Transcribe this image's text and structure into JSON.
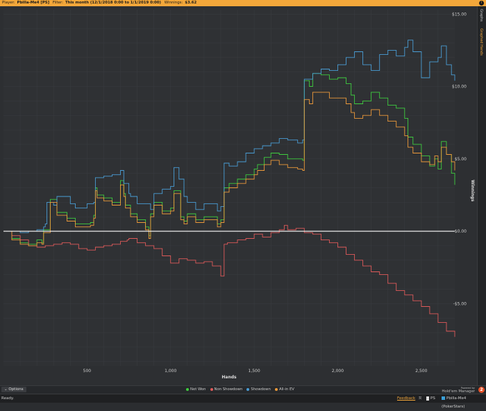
{
  "header": {
    "player_label": "Player:",
    "player_value": "Pbilla-Me4 [PS]",
    "filter_label": "Filter:",
    "filter_value": "This month (12/1/2018 0:00 to 1/1/2019 0:00)",
    "winnings_label": "Winnings:",
    "winnings_value": "$3.62",
    "info_icon": "info-icon"
  },
  "side_tabs": [
    "Graphs",
    "Graphed Hands"
  ],
  "chart_data": {
    "type": "line",
    "title": "",
    "xlabel": "Hands",
    "ylabel": "Winnings",
    "xlim": [
      0,
      2700
    ],
    "ylim": [
      -9.3,
      15.3
    ],
    "x_ticks": [
      500,
      1000,
      1500,
      2000,
      2500
    ],
    "x_tick_labels": [
      "500",
      "1,000",
      "1,500",
      "2,000",
      "2,500"
    ],
    "y_ticks": [
      -5,
      0,
      5,
      10,
      15
    ],
    "y_tick_labels": [
      "-$5.00",
      "$0.00",
      "$5.00",
      "$10.00",
      "$15.00"
    ],
    "grid": true,
    "legend": "bottom",
    "series": [
      {
        "name": "Net Won",
        "color": "#3fce3f",
        "x": [
          0,
          50,
          100,
          150,
          200,
          230,
          240,
          280,
          320,
          380,
          430,
          470,
          520,
          540,
          550,
          560,
          600,
          650,
          700,
          720,
          730,
          760,
          800,
          850,
          870,
          880,
          900,
          950,
          1000,
          1020,
          1060,
          1080,
          1100,
          1150,
          1200,
          1280,
          1300,
          1320,
          1350,
          1400,
          1450,
          1500,
          1520,
          1560,
          1600,
          1650,
          1700,
          1760,
          1790,
          1800,
          1830,
          1850,
          1900,
          1950,
          2000,
          2050,
          2080,
          2100,
          2150,
          2200,
          2250,
          2300,
          2350,
          2400,
          2420,
          2450,
          2500,
          2550,
          2580,
          2600,
          2620,
          2650,
          2680,
          2700
        ],
        "values": [
          0.0,
          -0.5,
          -0.8,
          -0.9,
          -0.6,
          -0.8,
          0.1,
          2.2,
          1.3,
          0.9,
          0.5,
          0.5,
          0.6,
          1.1,
          3.0,
          2.5,
          2.3,
          2.0,
          3.5,
          2.6,
          1.8,
          1.2,
          0.8,
          0.3,
          -0.3,
          1.2,
          2.0,
          1.4,
          1.6,
          2.8,
          1.0,
          0.7,
          1.2,
          0.8,
          1.0,
          0.5,
          0.8,
          3.0,
          3.3,
          3.6,
          3.9,
          4.3,
          4.6,
          5.1,
          5.4,
          5.3,
          5.0,
          5.0,
          4.9,
          10.4,
          10.0,
          10.9,
          10.8,
          10.5,
          10.6,
          10.2,
          9.4,
          8.8,
          9.0,
          9.6,
          9.2,
          8.7,
          8.5,
          7.8,
          6.5,
          6.0,
          5.2,
          4.5,
          5.0,
          4.3,
          6.2,
          5.3,
          4.0,
          3.2
        ]
      },
      {
        "name": "Non Showdown",
        "color": "#e05a5a",
        "x": [
          0,
          50,
          100,
          150,
          200,
          250,
          300,
          350,
          400,
          450,
          500,
          550,
          600,
          650,
          700,
          740,
          750,
          800,
          850,
          900,
          950,
          1000,
          1050,
          1100,
          1150,
          1200,
          1250,
          1300,
          1320,
          1340,
          1400,
          1450,
          1500,
          1550,
          1600,
          1650,
          1680,
          1700,
          1750,
          1800,
          1850,
          1900,
          1950,
          2000,
          2050,
          2100,
          2150,
          2200,
          2250,
          2300,
          2350,
          2400,
          2450,
          2500,
          2550,
          2600,
          2650,
          2700
        ],
        "values": [
          0.0,
          -0.3,
          -0.6,
          -1.0,
          -1.1,
          -1.0,
          -0.9,
          -0.8,
          -0.9,
          -1.2,
          -1.3,
          -1.1,
          -1.0,
          -0.9,
          -0.7,
          -0.6,
          -0.5,
          -0.8,
          -1.0,
          -1.2,
          -1.7,
          -2.2,
          -1.9,
          -2.0,
          -2.2,
          -2.1,
          -2.4,
          -3.1,
          -0.9,
          -0.8,
          -0.6,
          -0.5,
          -0.2,
          -0.4,
          -0.1,
          0.1,
          0.4,
          0.1,
          0.2,
          -0.1,
          -0.2,
          -0.6,
          -0.8,
          -1.1,
          -1.6,
          -2.0,
          -2.4,
          -2.8,
          -3.0,
          -3.6,
          -4.1,
          -4.4,
          -4.8,
          -5.2,
          -5.7,
          -6.3,
          -6.9,
          -7.3
        ]
      },
      {
        "name": "Showdown",
        "color": "#4a9ed6",
        "x": [
          0,
          100,
          150,
          200,
          240,
          250,
          260,
          300,
          320,
          400,
          430,
          500,
          540,
          550,
          600,
          650,
          700,
          720,
          750,
          760,
          800,
          850,
          880,
          900,
          950,
          1000,
          1020,
          1050,
          1080,
          1100,
          1150,
          1200,
          1280,
          1300,
          1320,
          1350,
          1400,
          1450,
          1500,
          1550,
          1600,
          1650,
          1700,
          1760,
          1790,
          1800,
          1850,
          1900,
          1950,
          2000,
          2050,
          2100,
          2150,
          2200,
          2250,
          2300,
          2350,
          2400,
          2420,
          2450,
          2500,
          2550,
          2600,
          2620,
          2650,
          2680,
          2700
        ],
        "values": [
          0.0,
          -0.1,
          0.0,
          0.1,
          0.3,
          0.5,
          2.0,
          1.8,
          2.4,
          1.9,
          1.6,
          1.9,
          2.0,
          3.7,
          3.8,
          3.9,
          4.2,
          3.3,
          2.6,
          2.4,
          1.9,
          1.9,
          1.5,
          2.6,
          2.9,
          3.1,
          4.4,
          3.6,
          2.4,
          2.0,
          1.5,
          1.9,
          1.4,
          1.7,
          4.7,
          4.5,
          4.8,
          5.4,
          5.7,
          5.9,
          6.1,
          6.4,
          6.3,
          6.1,
          6.3,
          10.5,
          10.9,
          11.2,
          11.1,
          11.5,
          12.0,
          12.4,
          11.5,
          11.1,
          12.2,
          12.5,
          12.1,
          12.7,
          13.2,
          12.4,
          10.6,
          11.7,
          12.0,
          12.8,
          11.5,
          10.8,
          10.4
        ]
      },
      {
        "name": "All-in EV",
        "color": "#ee9a3a",
        "x": [
          0,
          50,
          100,
          150,
          200,
          230,
          240,
          280,
          320,
          380,
          430,
          470,
          520,
          540,
          550,
          560,
          600,
          650,
          700,
          720,
          730,
          760,
          800,
          850,
          870,
          880,
          900,
          950,
          1000,
          1020,
          1060,
          1080,
          1100,
          1150,
          1200,
          1280,
          1300,
          1320,
          1350,
          1400,
          1450,
          1500,
          1520,
          1560,
          1600,
          1650,
          1700,
          1760,
          1790,
          1800,
          1830,
          1850,
          1900,
          1950,
          2000,
          2050,
          2080,
          2100,
          2150,
          2200,
          2250,
          2300,
          2350,
          2400,
          2420,
          2450,
          2500,
          2550,
          2580,
          2600,
          2620,
          2650,
          2680,
          2700
        ],
        "values": [
          0.0,
          -0.6,
          -0.9,
          -1.0,
          -0.8,
          -0.9,
          -0.1,
          2.0,
          1.1,
          0.7,
          0.3,
          0.3,
          0.4,
          0.9,
          2.8,
          2.3,
          2.1,
          1.8,
          3.2,
          2.4,
          1.6,
          1.0,
          0.6,
          0.1,
          -0.5,
          1.0,
          1.8,
          1.2,
          1.4,
          2.6,
          0.8,
          0.5,
          1.0,
          0.6,
          0.8,
          0.3,
          0.6,
          2.7,
          3.0,
          3.3,
          3.6,
          3.9,
          4.2,
          4.6,
          4.9,
          4.6,
          4.4,
          4.3,
          4.2,
          9.1,
          8.8,
          9.6,
          9.6,
          9.2,
          9.2,
          8.8,
          8.2,
          7.8,
          8.0,
          8.4,
          8.0,
          7.6,
          7.2,
          6.6,
          5.8,
          5.4,
          4.8,
          4.6,
          5.2,
          4.8,
          5.8,
          5.3,
          4.8,
          4.2
        ]
      }
    ]
  },
  "options_button": "Options",
  "branding": {
    "powered_by": "Powered by",
    "product": "Hold'em Manager",
    "badge": "2"
  },
  "status_bar": {
    "status": "Ready.",
    "feedback_link": "Feedback",
    "site_icon": "rss-icon",
    "site": "PS",
    "player": "Pbilla-Me4 (PokerStars)"
  }
}
